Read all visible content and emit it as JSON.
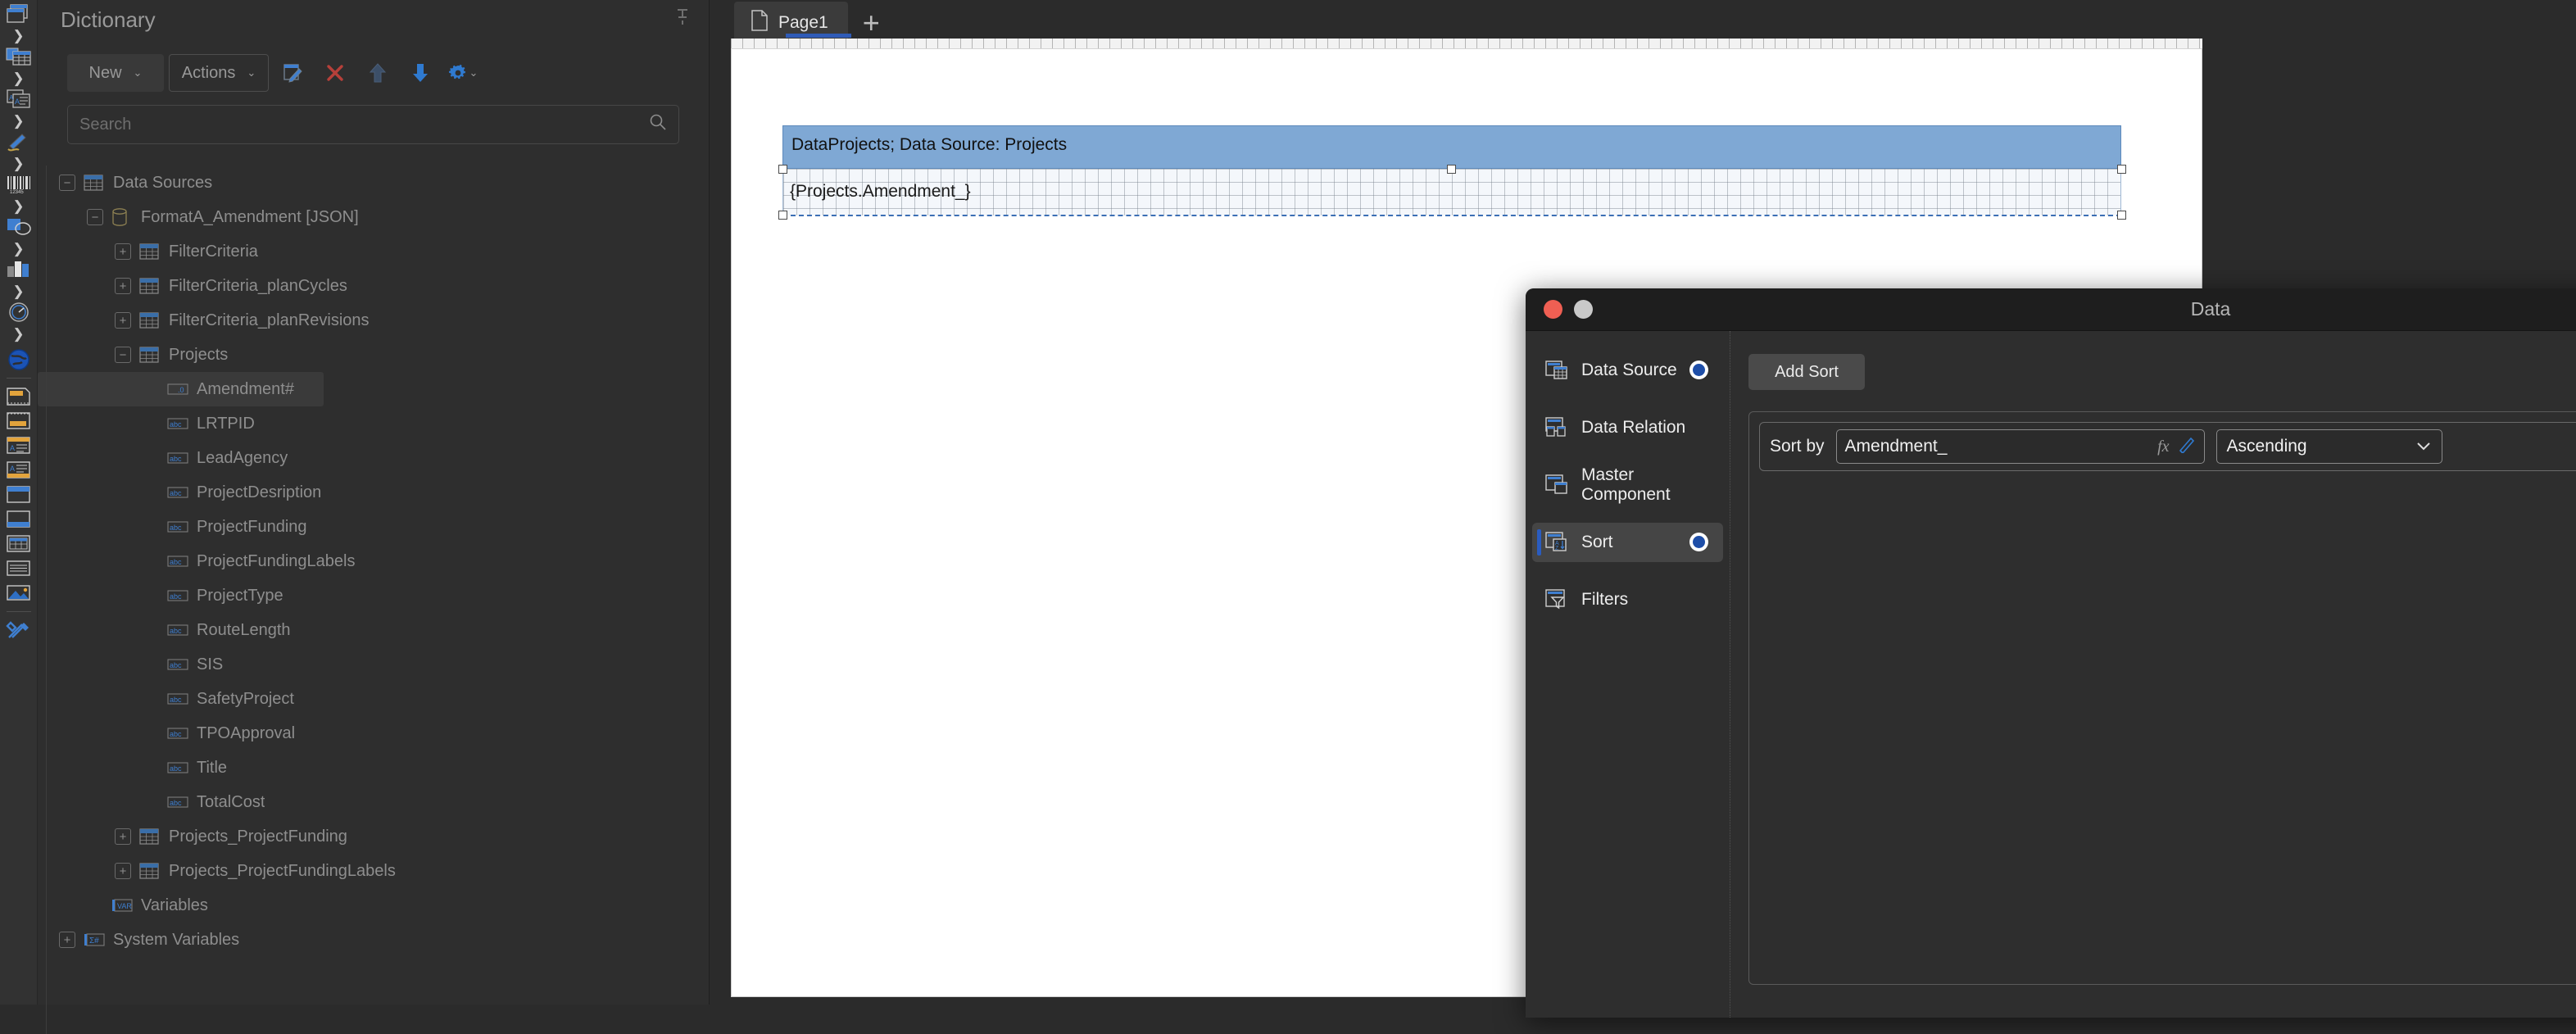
{
  "icon_rail": {
    "items": [
      {
        "name": "report-pages-icon",
        "expandable": true
      },
      {
        "name": "data-table-icon",
        "expandable": true
      },
      {
        "name": "text-blocks-icon",
        "expandable": true
      },
      {
        "name": "pencil-draw-icon",
        "expandable": true
      },
      {
        "name": "barcode-icon",
        "expandable": true
      },
      {
        "name": "shapes-icon",
        "expandable": true
      },
      {
        "name": "chart-icon",
        "expandable": true
      },
      {
        "name": "gauge-icon",
        "expandable": true
      },
      {
        "name": "globe-map-icon",
        "expandable": false
      },
      {
        "name": "report-title-band-icon",
        "expandable": false
      },
      {
        "name": "report-summary-band-icon",
        "expandable": false
      },
      {
        "name": "page-header-band-icon",
        "expandable": false
      },
      {
        "name": "page-footer-band-icon",
        "expandable": false
      },
      {
        "name": "group-header-band-icon",
        "expandable": false
      },
      {
        "name": "group-footer-band-icon",
        "expandable": false
      },
      {
        "name": "data-band-icon",
        "expandable": false
      },
      {
        "name": "text-lines-icon",
        "expandable": false
      },
      {
        "name": "image-icon",
        "expandable": false
      },
      {
        "name": "tools-icon",
        "expandable": false
      }
    ]
  },
  "dictionary": {
    "title": "Dictionary",
    "pin_icon": "pin-icon",
    "toolbar": {
      "new_label": "New",
      "actions_label": "Actions",
      "caret": "⌄",
      "edit_icon": "edit-icon",
      "delete_icon": "delete-x-icon",
      "move_up_icon": "arrow-up-icon",
      "move_down_icon": "arrow-down-icon",
      "settings_icon": "gear-icon"
    },
    "search": {
      "placeholder": "Search",
      "value": "",
      "icon": "search-icon"
    },
    "tree": [
      {
        "label": "Data Sources",
        "depth": 0,
        "expander": "minus",
        "icon": "table-icon",
        "selected": false
      },
      {
        "label": "FormatA_Amendment [JSON]",
        "depth": 1,
        "expander": "minus",
        "icon": "database-icon",
        "selected": false
      },
      {
        "label": "FilterCriteria",
        "depth": 2,
        "expander": "plus",
        "icon": "table-icon",
        "selected": false
      },
      {
        "label": "FilterCriteria_planCycles",
        "depth": 2,
        "expander": "plus",
        "icon": "table-icon",
        "selected": false
      },
      {
        "label": "FilterCriteria_planRevisions",
        "depth": 2,
        "expander": "plus",
        "icon": "table-icon",
        "selected": false
      },
      {
        "label": "Projects",
        "depth": 2,
        "expander": "minus",
        "icon": "table-icon",
        "selected": false
      },
      {
        "label": "Amendment#",
        "depth": 3,
        "expander": "none",
        "icon": "number-field-icon",
        "selected": true
      },
      {
        "label": "LRTPID",
        "depth": 3,
        "expander": "none",
        "icon": "text-field-icon",
        "selected": false
      },
      {
        "label": "LeadAgency",
        "depth": 3,
        "expander": "none",
        "icon": "text-field-icon",
        "selected": false
      },
      {
        "label": "ProjectDesription",
        "depth": 3,
        "expander": "none",
        "icon": "text-field-icon",
        "selected": false
      },
      {
        "label": "ProjectFunding",
        "depth": 3,
        "expander": "none",
        "icon": "text-field-icon",
        "selected": false
      },
      {
        "label": "ProjectFundingLabels",
        "depth": 3,
        "expander": "none",
        "icon": "text-field-icon",
        "selected": false
      },
      {
        "label": "ProjectType",
        "depth": 3,
        "expander": "none",
        "icon": "text-field-icon",
        "selected": false
      },
      {
        "label": "RouteLength",
        "depth": 3,
        "expander": "none",
        "icon": "text-field-icon",
        "selected": false
      },
      {
        "label": "SIS",
        "depth": 3,
        "expander": "none",
        "icon": "text-field-icon",
        "selected": false
      },
      {
        "label": "SafetyProject",
        "depth": 3,
        "expander": "none",
        "icon": "text-field-icon",
        "selected": false
      },
      {
        "label": "TPOApproval",
        "depth": 3,
        "expander": "none",
        "icon": "text-field-icon",
        "selected": false
      },
      {
        "label": "Title",
        "depth": 3,
        "expander": "none",
        "icon": "text-field-icon",
        "selected": false
      },
      {
        "label": "TotalCost",
        "depth": 3,
        "expander": "none",
        "icon": "text-field-icon",
        "selected": false
      },
      {
        "label": "Projects_ProjectFunding",
        "depth": 2,
        "expander": "plus",
        "icon": "table-icon",
        "selected": false
      },
      {
        "label": "Projects_ProjectFundingLabels",
        "depth": 2,
        "expander": "plus",
        "icon": "table-icon",
        "selected": false
      },
      {
        "label": "Variables",
        "depth": 1,
        "expander": "none",
        "icon": "variables-icon",
        "selected": false
      },
      {
        "label": "System Variables",
        "depth": 0,
        "expander": "plus",
        "icon": "system-variables-icon",
        "selected": false
      }
    ]
  },
  "workspace": {
    "tabs": [
      {
        "label": "Page1",
        "icon": "page-icon",
        "active": true
      }
    ],
    "add_tab_label": "+",
    "report": {
      "band_header": "DataProjects; Data Source: Projects",
      "band_field": "{Projects.Amendment_}"
    }
  },
  "modal": {
    "title": "Data",
    "window_controls": {
      "close": "close-dot",
      "minimize": "minimize-dot"
    },
    "nav": [
      {
        "label": "Data Source",
        "icon": "data-source-icon",
        "active": false,
        "radio": true
      },
      {
        "label": "Data Relation",
        "icon": "data-relation-icon",
        "active": false,
        "radio": false
      },
      {
        "label": "Master Component",
        "icon": "master-component-icon",
        "active": false,
        "radio": false
      },
      {
        "label": "Sort",
        "icon": "sort-az-icon",
        "active": true,
        "radio": true
      },
      {
        "label": "Filters",
        "icon": "filter-icon",
        "active": false,
        "radio": false
      }
    ],
    "add_sort_label": "Add Sort",
    "sorts": [
      {
        "label": "Sort by",
        "field_value": "Amendment_",
        "fx_label": "fx",
        "edit_icon": "pencil-icon",
        "direction": "Ascending",
        "direction_caret": "⌄",
        "remove_label": "✕"
      }
    ]
  },
  "colors": {
    "accent_blue": "#2a5cc0",
    "band_blue": "#7fa8d4",
    "close_red": "#ef5f53",
    "panel_bg": "#2e2e2e",
    "rail_bg": "#323232"
  }
}
